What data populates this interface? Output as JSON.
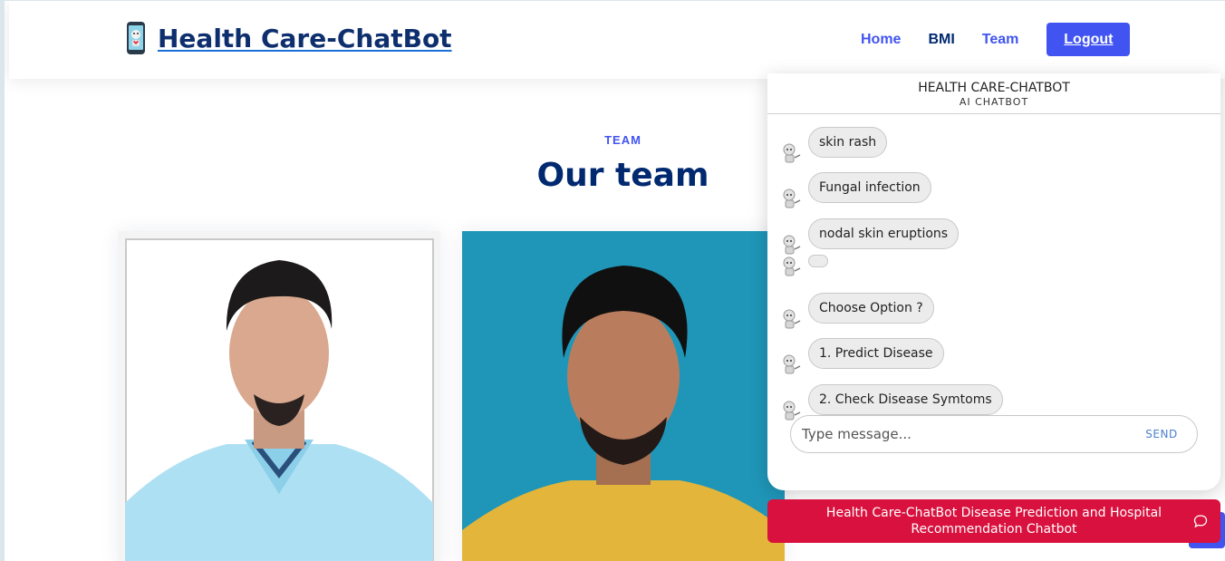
{
  "header": {
    "logo_text": " Health Care-ChatBot",
    "nav": {
      "home": "Home",
      "bmi": "BMI",
      "team": "Team",
      "logout": "Logout"
    }
  },
  "team_section": {
    "tag": "TEAM",
    "title": "Our team"
  },
  "chat": {
    "title": "HEALTH CARE-CHATBOT",
    "subtitle": "AI CHATBOT",
    "messages": [
      "skin rash",
      "Fungal infection",
      "nodal skin eruptions",
      "",
      "Choose Option ?",
      "1. Predict Disease",
      "2. Check Disease Symtoms"
    ],
    "input_placeholder": "Type message...",
    "send_label": "SEND",
    "banner_text": "Health Care-ChatBot Disease Prediction and Hospital Recommendation Chatbot"
  },
  "colors": {
    "primary": "#4154f1",
    "navy": "#012970",
    "banner": "#d9113e"
  }
}
